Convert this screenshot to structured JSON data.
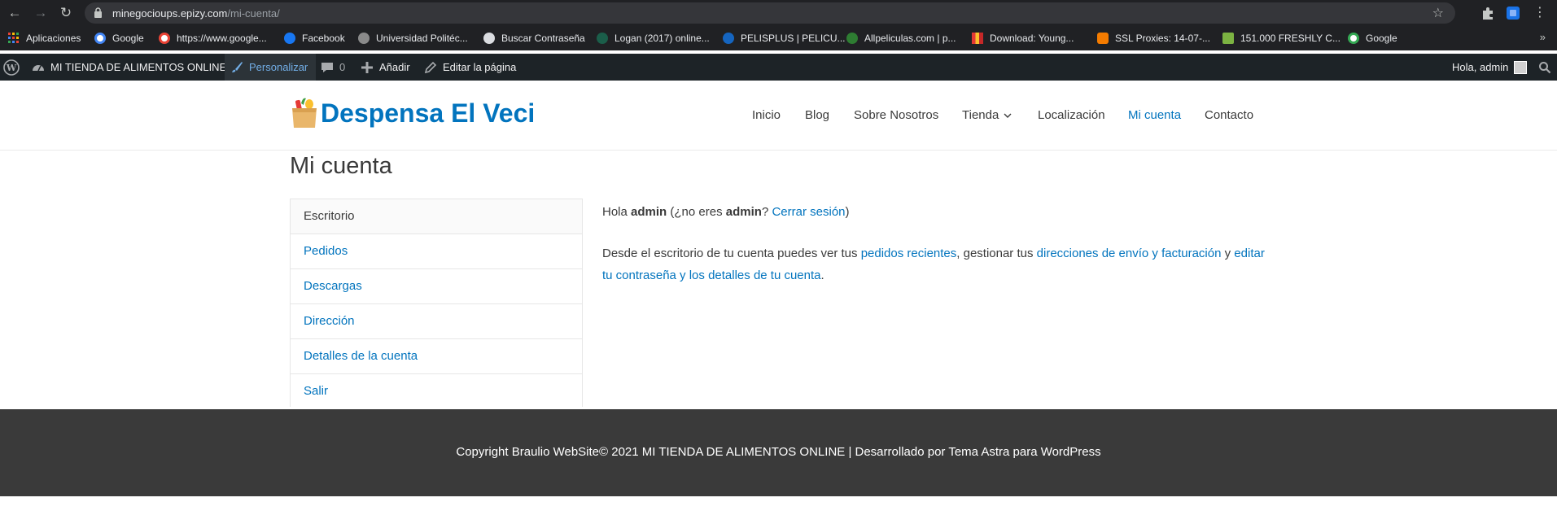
{
  "browser": {
    "url_host": "minegocioups.epizy.com",
    "url_path": "/mi-cuenta/",
    "back_icon": "←",
    "forward_icon": "→",
    "reload_icon": "↻",
    "star_icon": "☆",
    "menu_icon": "⋮",
    "bookmarks_more": "»",
    "bookmarks": [
      {
        "label": "Aplicaciones",
        "icon": "apps-grid-icon"
      },
      {
        "label": "Google",
        "icon": "google-icon"
      },
      {
        "label": "https://www.google...",
        "icon": "google-icon"
      },
      {
        "label": "Facebook",
        "icon": "facebook-icon"
      },
      {
        "label": "Universidad Politéc...",
        "icon": "university-icon"
      },
      {
        "label": "Buscar Contraseña",
        "icon": "globe-icon"
      },
      {
        "label": "Logan (2017) online...",
        "icon": "logan-icon"
      },
      {
        "label": "PELISPLUS | PELICU...",
        "icon": "pelisplus-icon"
      },
      {
        "label": "Allpeliculas.com | p...",
        "icon": "allpeliculas-icon"
      },
      {
        "label": "Download: Young...",
        "icon": "download-icon"
      },
      {
        "label": "SSL Proxies: 14-07-...",
        "icon": "blogger-icon"
      },
      {
        "label": "151.000 FRESHLY C...",
        "icon": "freshly-icon"
      },
      {
        "label": "Google",
        "icon": "google-icon"
      }
    ]
  },
  "admin_bar": {
    "site_name": "MI TIENDA DE ALIMENTOS ONLINE",
    "customize": "Personalizar",
    "comments_count": "0",
    "add_new": "Añadir",
    "edit_page": "Editar la página",
    "greeting": "Hola, admin"
  },
  "header": {
    "site_title": "Despensa El Veci",
    "menu": [
      {
        "label": "Inicio"
      },
      {
        "label": "Blog"
      },
      {
        "label": "Sobre Nosotros"
      },
      {
        "label": "Tienda"
      },
      {
        "label": "Localización"
      },
      {
        "label": "Mi cuenta"
      },
      {
        "label": "Contacto"
      }
    ]
  },
  "page": {
    "title": "Mi cuenta",
    "account_nav": [
      "Escritorio",
      "Pedidos",
      "Descargas",
      "Dirección",
      "Detalles de la cuenta",
      "Salir"
    ],
    "greeting": {
      "hello": "Hola",
      "user": "admin",
      "not_you_open": "(¿no eres",
      "user2": "admin",
      "question": "?",
      "logout": "Cerrar sesión",
      "close": ")"
    },
    "dashboard": {
      "text1": "Desde el escritorio de tu cuenta puedes ver tus",
      "link_orders": "pedidos recientes",
      "text2": ", gestionar tus",
      "link_addresses": "direcciones de envío y facturación",
      "text3": "y",
      "link_account": "editar tu contraseña y los detalles de tu cuenta",
      "text4": "."
    }
  },
  "footer": {
    "copyright": "Copyright Braulio WebSite© 2021 MI TIENDA DE ALIMENTOS ONLINE | Desarrollado por",
    "credit_link": "Tema Astra para WordPress"
  },
  "colors": {
    "accent": "#0274be",
    "footer_bg": "#3a3a3a",
    "adminbar_bg": "#1d2327"
  }
}
